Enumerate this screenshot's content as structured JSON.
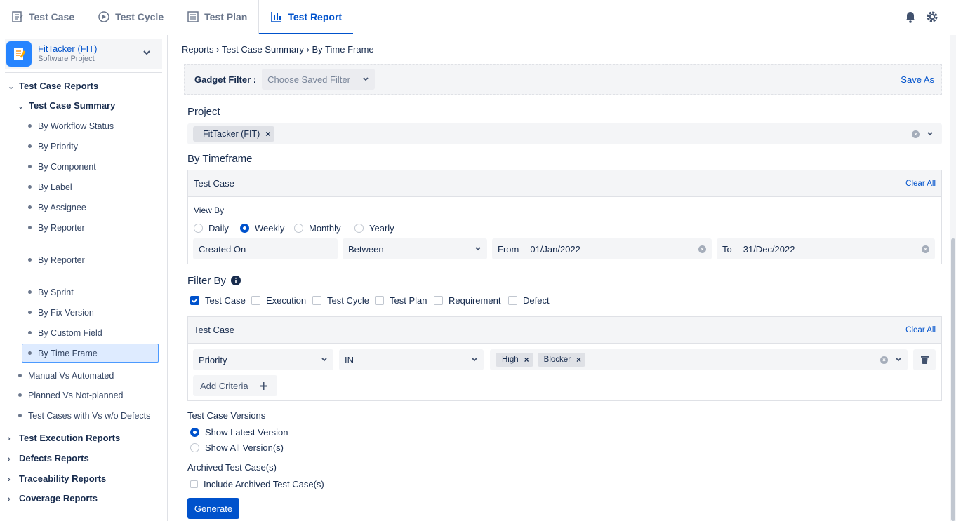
{
  "top_tabs": [
    {
      "label": "Test Case"
    },
    {
      "label": "Test Cycle"
    },
    {
      "label": "Test Plan"
    },
    {
      "label": "Test Report"
    }
  ],
  "project": {
    "name": "FitTacker (FIT)",
    "type": "Software Project"
  },
  "sidebar": {
    "test_case_reports": "Test Case Reports",
    "test_case_summary": "Test Case Summary",
    "summary_items": [
      "By Workflow Status",
      "By Priority",
      "By Component",
      "By Label",
      "By Assignee",
      "By Reporter",
      "By Reporter",
      "By Sprint",
      "By Fix Version",
      "By Custom Field",
      "By Time Frame"
    ],
    "other_items": [
      "Manual Vs Automated",
      "Planned Vs Not-planned",
      "Test Cases with Vs w/o Defects"
    ],
    "groups": [
      "Test Execution Reports",
      "Defects Reports",
      "Traceability Reports",
      "Coverage Reports"
    ]
  },
  "breadcrumb": {
    "root": "Reports",
    "mid": "Test Case Summary",
    "current": "By Time Frame"
  },
  "gadget": {
    "label": "Gadget Filter :",
    "placeholder": "Choose Saved Filter",
    "save_as": "Save As"
  },
  "project_section": {
    "label": "Project",
    "chip": "FitTacker (FIT)"
  },
  "timeframe": {
    "label": "By Timeframe",
    "panel_title": "Test Case",
    "clear_all": "Clear All",
    "view_by": "View By",
    "options": [
      "Daily",
      "Weekly",
      "Monthly",
      "Yearly"
    ],
    "selected": "Weekly",
    "field": "Created On",
    "operator": "Between",
    "from_label": "From",
    "from_value": "01/Jan/2022",
    "to_label": "To",
    "to_value": "31/Dec/2022"
  },
  "filter_by": {
    "label": "Filter By",
    "options": [
      "Test Case",
      "Execution",
      "Test Cycle",
      "Test Plan",
      "Requirement",
      "Defect"
    ],
    "checked": "Test Case",
    "panel_title": "Test Case",
    "clear_all": "Clear All",
    "criteria_field": "Priority",
    "criteria_op": "IN",
    "criteria_values": [
      "High",
      "Blocker"
    ],
    "add_criteria": "Add Criteria"
  },
  "versions": {
    "label": "Test Case Versions",
    "options": [
      "Show Latest Version",
      "Show All Version(s)"
    ],
    "selected": "Show Latest Version"
  },
  "archived": {
    "label": "Archived Test Case(s)",
    "checkbox": "Include Archived Test Case(s)"
  },
  "generate": "Generate",
  "colors": {
    "accent": "#0052cc",
    "panel": "#f4f5f7",
    "border": "#dfe1e6"
  }
}
